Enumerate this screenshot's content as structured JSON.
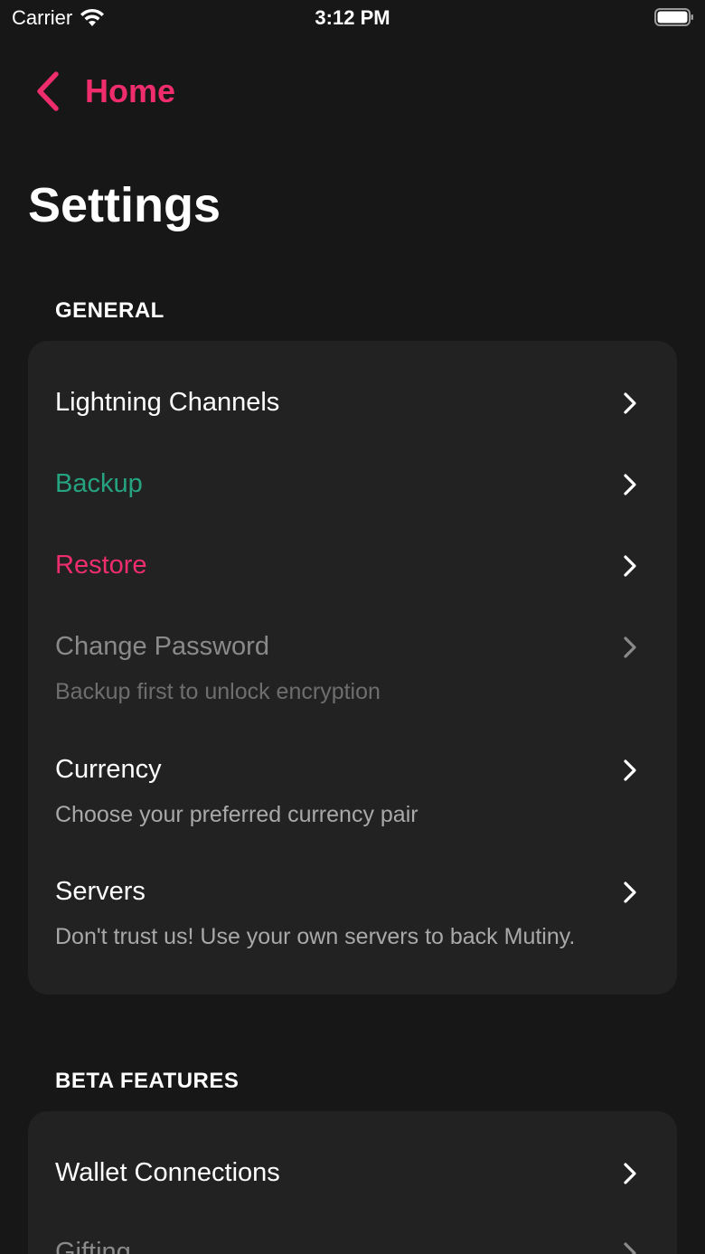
{
  "status_bar": {
    "carrier": "Carrier",
    "time": "3:12 PM",
    "icons": [
      "wifi-icon",
      "battery-icon"
    ]
  },
  "nav": {
    "back_label": "Home",
    "back_icon": "chevron-left-icon"
  },
  "page": {
    "title": "Settings"
  },
  "colors": {
    "accent": "#ef2d6d",
    "success": "#26a380",
    "background": "#171717",
    "card": "#222222"
  },
  "sections": {
    "general": {
      "header": "GENERAL",
      "items": [
        {
          "label": "Lightning Channels"
        },
        {
          "label": "Backup"
        },
        {
          "label": "Restore"
        },
        {
          "label": "Change Password",
          "caption": "Backup first to unlock encryption"
        },
        {
          "label": "Currency",
          "caption": "Choose your preferred currency pair"
        },
        {
          "label": "Servers",
          "caption": "Don't trust us! Use your own servers to back Mutiny."
        }
      ]
    },
    "beta": {
      "header": "BETA FEATURES",
      "items": [
        {
          "label": "Wallet Connections"
        },
        {
          "label": "Gifting"
        }
      ]
    }
  }
}
